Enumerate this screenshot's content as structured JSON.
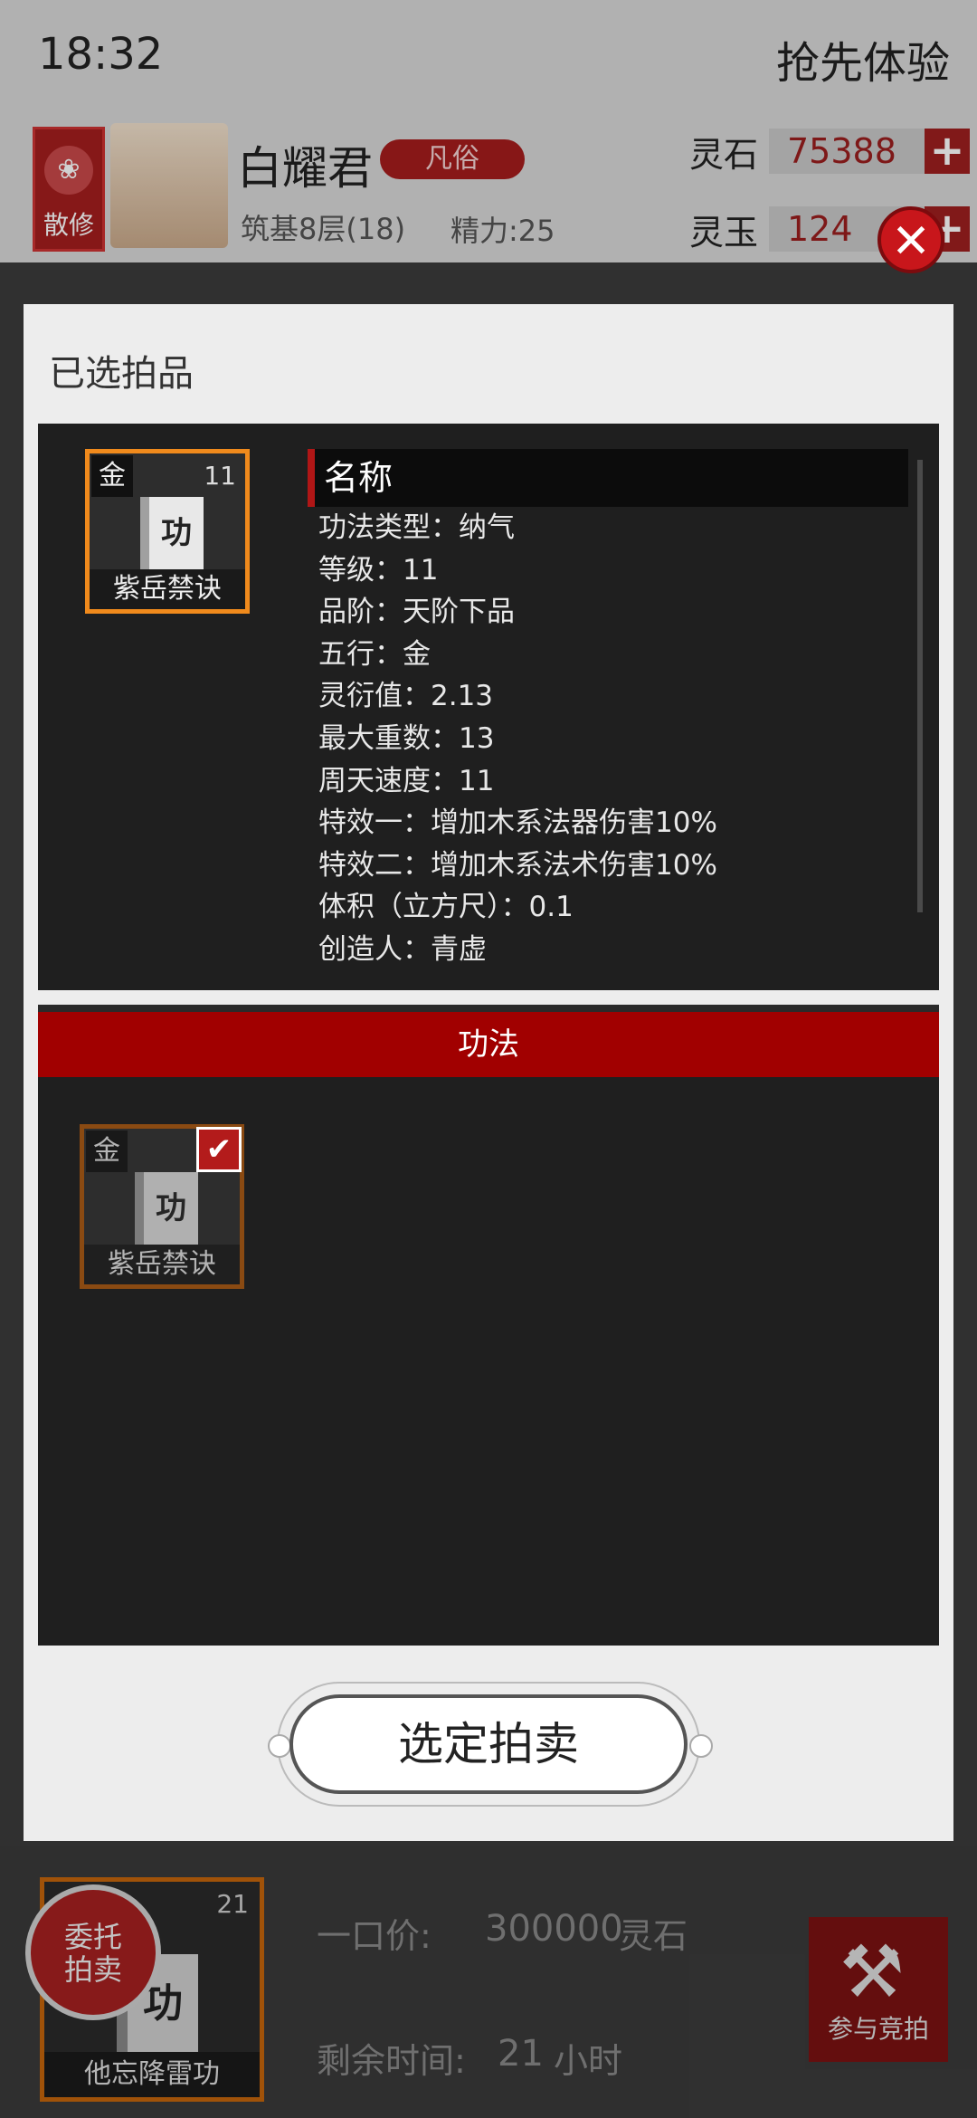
{
  "status": {
    "time": "18:32",
    "title": "抢先体验"
  },
  "player": {
    "sect_label": "散修",
    "name": "白耀君",
    "realm_badge": "凡俗",
    "level": "筑基8层(18)",
    "energy": "精力:25"
  },
  "resources": [
    {
      "label": "灵石",
      "value": "75388"
    },
    {
      "label": "灵玉",
      "value": "124"
    }
  ],
  "modal": {
    "title": "已选拍品",
    "selected_item": {
      "element": "金",
      "level": "11",
      "glyph": "功",
      "name": "紫岳禁诀"
    },
    "detail": {
      "name_header": "名称",
      "attributes": [
        "功法类型：纳气",
        "等级：11",
        "品阶：天阶下品",
        "五行：金",
        "灵衍值：2.13",
        "最大重数：13",
        "周天速度：11",
        "特效一：增加木系法器伤害10%",
        "特效二：增加木系法术伤害10%",
        "体积（立方尺）：0.1",
        "创造人：青虚"
      ]
    },
    "category": "功法",
    "list_items": [
      {
        "element": "金",
        "glyph": "功",
        "name": "紫岳禁诀",
        "checked": true
      }
    ],
    "confirm_label": "选定拍卖"
  },
  "listing": {
    "level": "21",
    "glyph": "功",
    "name": "他忘降雷功",
    "consign_label_1": "委托",
    "consign_label_2": "拍卖",
    "price_label": "一口价:",
    "price_value": "300000",
    "price_unit": "灵石",
    "time_label": "剩余时间:",
    "time_value": "21",
    "time_unit": "小时",
    "bid_label": "参与竞拍"
  },
  "colors": {
    "accent_red": "#a10000",
    "select_orange": "#f08a1c"
  }
}
